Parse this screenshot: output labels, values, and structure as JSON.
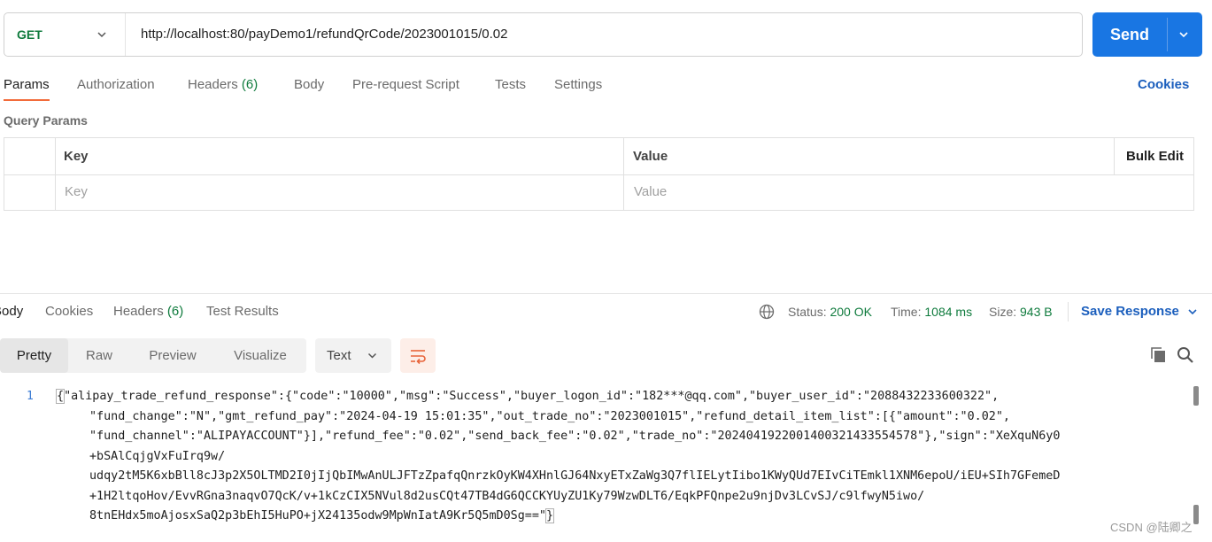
{
  "request": {
    "method": "GET",
    "url": "http://localhost:80/payDemo1/refundQrCode/2023001015/0.02",
    "send_label": "Send"
  },
  "request_tabs": [
    {
      "label": "Params",
      "active": true
    },
    {
      "label": "Authorization"
    },
    {
      "label": "Headers",
      "count": "(6)"
    },
    {
      "label": "Body"
    },
    {
      "label": "Pre-request Script"
    },
    {
      "label": "Tests"
    },
    {
      "label": "Settings"
    }
  ],
  "cookies_link": "Cookies",
  "query_params": {
    "title": "Query Params",
    "col_key": "Key",
    "col_value": "Value",
    "bulk_edit": "Bulk Edit",
    "key_placeholder": "Key",
    "value_placeholder": "Value"
  },
  "response_tabs": [
    {
      "label": "Body",
      "active": true
    },
    {
      "label": "Cookies"
    },
    {
      "label": "Headers",
      "count": "(6)"
    },
    {
      "label": "Test Results"
    }
  ],
  "response_meta": {
    "status_label": "Status:",
    "status_value": "200 OK",
    "time_label": "Time:",
    "time_value": "1084 ms",
    "size_label": "Size:",
    "size_value": "943 B",
    "save_response": "Save Response"
  },
  "view_modes": [
    "Pretty",
    "Raw",
    "Preview",
    "Visualize"
  ],
  "active_view_mode": "Pretty",
  "format": "Text",
  "code": {
    "line_number": "1",
    "open_brace": "{",
    "line1": "\"alipay_trade_refund_response\":{\"code\":\"10000\",\"msg\":\"Success\",\"buyer_logon_id\":\"182***@qq.com\",\"buyer_user_id\":\"2088432233600322\",",
    "line2": "\"fund_change\":\"N\",\"gmt_refund_pay\":\"2024-04-19 15:01:35\",\"out_trade_no\":\"2023001015\",\"refund_detail_item_list\":[{\"amount\":\"0.02\",",
    "line3": "\"fund_channel\":\"ALIPAYACCOUNT\"}],\"refund_fee\":\"0.02\",\"send_back_fee\":\"0.02\",\"trade_no\":\"2024041922001400321433554578\"},\"sign\":\"XeXquN6y0",
    "line4": "+bSAlCqjgVxFuIrq9w/",
    "line5": "udqy2tM5K6xbBll8cJ3p2X5OLTMD2I0jIjQbIMwAnULJFTzZpafqQnrzkOyKW4XHnlGJ64NxyETxZaWg3Q7flIELytIibo1KWyQUd7EIvCiTEmkl1XNM6epoU/iEU+SIh7GFemeD",
    "line6": "+1H2ltqoHov/EvvRGna3naqvO7QcK/v+1kCzCIX5NVul8d2usCQt47TB4dG6QCCKYUyZU1Ky79WzwDLT6/EqkPFQnpe2u9njDv3LCvSJ/c9lfwyN5iwo/",
    "line7": "8tnEHdx5moAjosxSaQ2p3bEhI5HuPO+jX24135odw9MpWnIatA9Kr5Q5mD0Sg==\"",
    "close_brace": "}"
  },
  "watermark": "CSDN @陆卿之"
}
